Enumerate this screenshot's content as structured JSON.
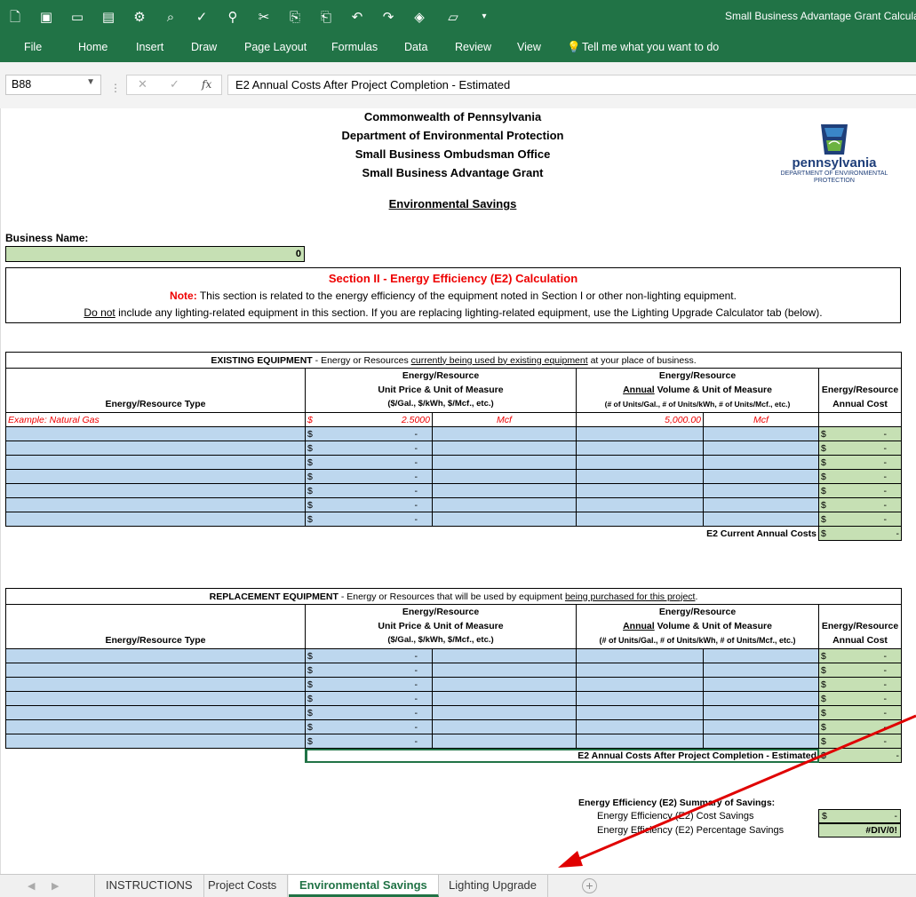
{
  "window": {
    "title": "Small Business Advantage Grant Calcula",
    "qat_icons": [
      "new-icon",
      "save-as-icon",
      "save-icon",
      "save-all-icon",
      "format-painter-icon",
      "print-preview-icon",
      "spelling-icon",
      "find-icon",
      "cut-icon",
      "copy-icon",
      "paste-icon",
      "undo-icon",
      "redo-icon",
      "fill-color-icon",
      "open-icon",
      "customize-icon"
    ]
  },
  "menu": [
    "File",
    "Home",
    "Insert",
    "Draw",
    "Page Layout",
    "Formulas",
    "Data",
    "Review",
    "View"
  ],
  "tell_me": "Tell me what you want to do",
  "formula_bar": {
    "name_box": "B88",
    "fx": "fx",
    "content": "E2  Annual Costs After Project Completion - Estimated"
  },
  "header": {
    "lines": [
      "Commonwealth of Pennsylvania",
      "Department of Environmental Protection",
      "Small Business Ombudsman Office",
      "Small Business Advantage Grant"
    ],
    "subtitle": "Environmental  Savings",
    "logo_word": "pennsylvania",
    "logo_sub1": "DEPARTMENT OF ENVIRONMENTAL",
    "logo_sub2": "PROTECTION"
  },
  "business": {
    "label": "Business Name:",
    "value": "0"
  },
  "section": {
    "title": "Section II - Energy Efficiency (E2) Calculation",
    "note_label": "Note:",
    "note_text": " This section is related to the energy efficiency of the equipment noted in Section I or other non-lighting equipment.",
    "line2_u": "Do not",
    "line2_text": " include any lighting-related equipment in this section.  If you are replacing lighting-related equipment, use the Lighting Upgrade Calculator tab (below)."
  },
  "existing": {
    "title_bold": "EXISTING EQUIPMENT",
    "title_mid": "  -  Energy or Resources ",
    "title_u": "currently being used by existing equipment",
    "title_end": " at your place of business.",
    "col_type": "Energy/Resource Type",
    "col_price_1": "Energy/Resource",
    "col_price_2": "Unit Price & Unit of Measure",
    "col_price_3": "($/Gal., $/kWh, $/Mcf., etc.)",
    "col_vol_1": "Energy/Resource",
    "col_vol_2u": "Annual",
    "col_vol_2": " Volume & Unit of Measure",
    "col_vol_3": "(# of Units/Gal., # of Units/kWh, # of Units/Mcf., etc.)",
    "col_cost_1": "Energy/Resource",
    "col_cost_2": "Annual Cost",
    "example": {
      "type": "Example:  Natural Gas",
      "cur": "$",
      "price": "2.5000",
      "unit": "Mcf",
      "volume": "5,000.00",
      "vunit": "Mcf"
    },
    "rows": [
      {
        "cur": "$",
        "price": "-",
        "cost_cur": "$",
        "cost": "-"
      },
      {
        "cur": "$",
        "price": "-",
        "cost_cur": "$",
        "cost": "-"
      },
      {
        "cur": "$",
        "price": "-",
        "cost_cur": "$",
        "cost": "-"
      },
      {
        "cur": "$",
        "price": "-",
        "cost_cur": "$",
        "cost": "-"
      },
      {
        "cur": "$",
        "price": "-",
        "cost_cur": "$",
        "cost": "-"
      },
      {
        "cur": "$",
        "price": "-",
        "cost_cur": "$",
        "cost": "-"
      },
      {
        "cur": "$",
        "price": "-",
        "cost_cur": "$",
        "cost": "-"
      }
    ],
    "total_label": "E2  Current Annual Costs",
    "total_cur": "$",
    "total_val": "-"
  },
  "replacement": {
    "title_bold": "REPLACEMENT EQUIPMENT",
    "title_mid": " - Energy or Resources that will be used by equipment ",
    "title_u": "being purchased for this project",
    "title_end": ".",
    "col_vol_3": "(# of Units/Gal., # of Units/kWh, # of Units/Mcf., etc.)",
    "rows": [
      {
        "cur": "$",
        "price": "-",
        "cost_cur": "$",
        "cost": "-"
      },
      {
        "cur": "$",
        "price": "-",
        "cost_cur": "$",
        "cost": "-"
      },
      {
        "cur": "$",
        "price": "-",
        "cost_cur": "$",
        "cost": "-"
      },
      {
        "cur": "$",
        "price": "-",
        "cost_cur": "$",
        "cost": "-"
      },
      {
        "cur": "$",
        "price": "-",
        "cost_cur": "$",
        "cost": "-"
      },
      {
        "cur": "$",
        "price": "-",
        "cost_cur": "$",
        "cost": "-"
      },
      {
        "cur": "$",
        "price": "-",
        "cost_cur": "$",
        "cost": "-"
      }
    ],
    "total_label": "E2  Annual Costs After Project Completion - Estimated",
    "total_cur": "$",
    "total_val": "-"
  },
  "summary": {
    "title": "Energy Efficiency (E2) Summary of Savings:",
    "cost_label": "Energy Efficiency (E2) Cost Savings",
    "cost_cur": "$",
    "cost_val": "-",
    "pct_label": "Energy Efficiency (E2) Percentage Savings",
    "pct_val": "#DIV/0!"
  },
  "tabs": [
    "INSTRUCTIONS",
    "Project Costs",
    "Environmental Savings",
    "Lighting Upgrade"
  ],
  "active_tab": "Environmental Savings",
  "colors": {
    "excel_green": "#217346",
    "input_blue": "#bdd7ee",
    "calc_green": "#c6e0b4",
    "accent_red": "#e00000"
  }
}
